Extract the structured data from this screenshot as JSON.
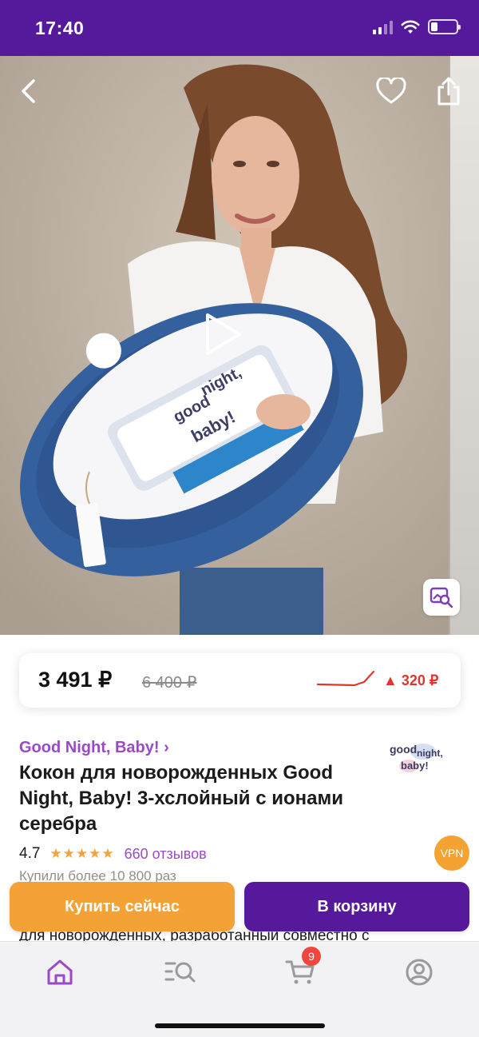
{
  "status_bar": {
    "time": "17:40"
  },
  "gallery": {
    "icons": {
      "back": "chevron-left-icon",
      "favorite": "heart-icon",
      "share": "share-icon",
      "play": "play-icon",
      "visual_search": "image-search-icon"
    },
    "packaging_logo": [
      "good",
      "night,",
      "baby!"
    ]
  },
  "price": {
    "current": "3 491 ₽",
    "old": "6 400 ₽",
    "change": "▲ 320 ₽",
    "trend_color": "#e1342e"
  },
  "product": {
    "brand": "Good Night, Baby! ›",
    "brand_logo": [
      "good",
      "night,",
      "baby!"
    ],
    "title": "Кокон для новорожденных Good Night, Baby! 3-хслойный с ионами серебра",
    "rating": "4.7",
    "stars": "★★★★★",
    "rating_fraction": 0.94,
    "reviews": "660 отзывов",
    "purchases": "Купили более 10 800 раз",
    "description_fragment": "для новорожденных, разработанный совместно с",
    "vpn_badge": "VPN"
  },
  "actions": {
    "buy_now": "Купить сейчас",
    "add_to_cart": "В корзину"
  },
  "tab_bar": {
    "items": [
      {
        "name": "home",
        "icon": "home-icon",
        "active": true
      },
      {
        "name": "catalog",
        "icon": "search-list-icon",
        "active": false
      },
      {
        "name": "cart",
        "icon": "cart-icon",
        "active": false,
        "badge": "9"
      },
      {
        "name": "profile",
        "icon": "profile-icon",
        "active": false
      }
    ]
  },
  "colors": {
    "brand_purple": "#55199b",
    "accent_purple": "#9a49c9",
    "orange": "#f4a236",
    "badge_red": "#f2453d"
  }
}
